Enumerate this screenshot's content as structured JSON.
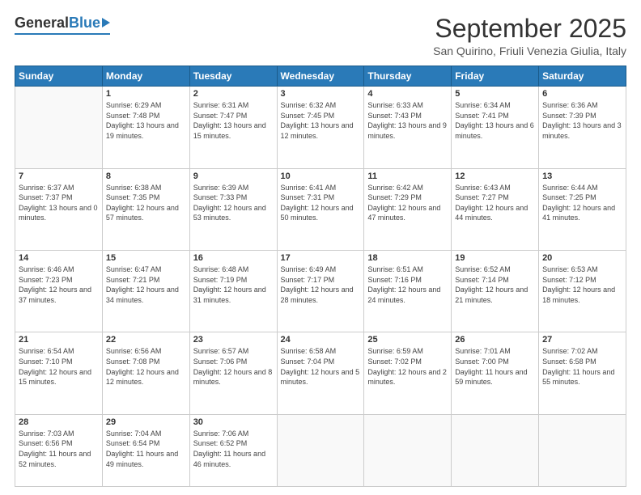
{
  "logo": {
    "general": "General",
    "blue": "Blue"
  },
  "header": {
    "month": "September 2025",
    "location": "San Quirino, Friuli Venezia Giulia, Italy"
  },
  "weekdays": [
    "Sunday",
    "Monday",
    "Tuesday",
    "Wednesday",
    "Thursday",
    "Friday",
    "Saturday"
  ],
  "weeks": [
    [
      {
        "day": "",
        "sunrise": "",
        "sunset": "",
        "daylight": ""
      },
      {
        "day": "1",
        "sunrise": "Sunrise: 6:29 AM",
        "sunset": "Sunset: 7:48 PM",
        "daylight": "Daylight: 13 hours and 19 minutes."
      },
      {
        "day": "2",
        "sunrise": "Sunrise: 6:31 AM",
        "sunset": "Sunset: 7:47 PM",
        "daylight": "Daylight: 13 hours and 15 minutes."
      },
      {
        "day": "3",
        "sunrise": "Sunrise: 6:32 AM",
        "sunset": "Sunset: 7:45 PM",
        "daylight": "Daylight: 13 hours and 12 minutes."
      },
      {
        "day": "4",
        "sunrise": "Sunrise: 6:33 AM",
        "sunset": "Sunset: 7:43 PM",
        "daylight": "Daylight: 13 hours and 9 minutes."
      },
      {
        "day": "5",
        "sunrise": "Sunrise: 6:34 AM",
        "sunset": "Sunset: 7:41 PM",
        "daylight": "Daylight: 13 hours and 6 minutes."
      },
      {
        "day": "6",
        "sunrise": "Sunrise: 6:36 AM",
        "sunset": "Sunset: 7:39 PM",
        "daylight": "Daylight: 13 hours and 3 minutes."
      }
    ],
    [
      {
        "day": "7",
        "sunrise": "Sunrise: 6:37 AM",
        "sunset": "Sunset: 7:37 PM",
        "daylight": "Daylight: 13 hours and 0 minutes."
      },
      {
        "day": "8",
        "sunrise": "Sunrise: 6:38 AM",
        "sunset": "Sunset: 7:35 PM",
        "daylight": "Daylight: 12 hours and 57 minutes."
      },
      {
        "day": "9",
        "sunrise": "Sunrise: 6:39 AM",
        "sunset": "Sunset: 7:33 PM",
        "daylight": "Daylight: 12 hours and 53 minutes."
      },
      {
        "day": "10",
        "sunrise": "Sunrise: 6:41 AM",
        "sunset": "Sunset: 7:31 PM",
        "daylight": "Daylight: 12 hours and 50 minutes."
      },
      {
        "day": "11",
        "sunrise": "Sunrise: 6:42 AM",
        "sunset": "Sunset: 7:29 PM",
        "daylight": "Daylight: 12 hours and 47 minutes."
      },
      {
        "day": "12",
        "sunrise": "Sunrise: 6:43 AM",
        "sunset": "Sunset: 7:27 PM",
        "daylight": "Daylight: 12 hours and 44 minutes."
      },
      {
        "day": "13",
        "sunrise": "Sunrise: 6:44 AM",
        "sunset": "Sunset: 7:25 PM",
        "daylight": "Daylight: 12 hours and 41 minutes."
      }
    ],
    [
      {
        "day": "14",
        "sunrise": "Sunrise: 6:46 AM",
        "sunset": "Sunset: 7:23 PM",
        "daylight": "Daylight: 12 hours and 37 minutes."
      },
      {
        "day": "15",
        "sunrise": "Sunrise: 6:47 AM",
        "sunset": "Sunset: 7:21 PM",
        "daylight": "Daylight: 12 hours and 34 minutes."
      },
      {
        "day": "16",
        "sunrise": "Sunrise: 6:48 AM",
        "sunset": "Sunset: 7:19 PM",
        "daylight": "Daylight: 12 hours and 31 minutes."
      },
      {
        "day": "17",
        "sunrise": "Sunrise: 6:49 AM",
        "sunset": "Sunset: 7:17 PM",
        "daylight": "Daylight: 12 hours and 28 minutes."
      },
      {
        "day": "18",
        "sunrise": "Sunrise: 6:51 AM",
        "sunset": "Sunset: 7:16 PM",
        "daylight": "Daylight: 12 hours and 24 minutes."
      },
      {
        "day": "19",
        "sunrise": "Sunrise: 6:52 AM",
        "sunset": "Sunset: 7:14 PM",
        "daylight": "Daylight: 12 hours and 21 minutes."
      },
      {
        "day": "20",
        "sunrise": "Sunrise: 6:53 AM",
        "sunset": "Sunset: 7:12 PM",
        "daylight": "Daylight: 12 hours and 18 minutes."
      }
    ],
    [
      {
        "day": "21",
        "sunrise": "Sunrise: 6:54 AM",
        "sunset": "Sunset: 7:10 PM",
        "daylight": "Daylight: 12 hours and 15 minutes."
      },
      {
        "day": "22",
        "sunrise": "Sunrise: 6:56 AM",
        "sunset": "Sunset: 7:08 PM",
        "daylight": "Daylight: 12 hours and 12 minutes."
      },
      {
        "day": "23",
        "sunrise": "Sunrise: 6:57 AM",
        "sunset": "Sunset: 7:06 PM",
        "daylight": "Daylight: 12 hours and 8 minutes."
      },
      {
        "day": "24",
        "sunrise": "Sunrise: 6:58 AM",
        "sunset": "Sunset: 7:04 PM",
        "daylight": "Daylight: 12 hours and 5 minutes."
      },
      {
        "day": "25",
        "sunrise": "Sunrise: 6:59 AM",
        "sunset": "Sunset: 7:02 PM",
        "daylight": "Daylight: 12 hours and 2 minutes."
      },
      {
        "day": "26",
        "sunrise": "Sunrise: 7:01 AM",
        "sunset": "Sunset: 7:00 PM",
        "daylight": "Daylight: 11 hours and 59 minutes."
      },
      {
        "day": "27",
        "sunrise": "Sunrise: 7:02 AM",
        "sunset": "Sunset: 6:58 PM",
        "daylight": "Daylight: 11 hours and 55 minutes."
      }
    ],
    [
      {
        "day": "28",
        "sunrise": "Sunrise: 7:03 AM",
        "sunset": "Sunset: 6:56 PM",
        "daylight": "Daylight: 11 hours and 52 minutes."
      },
      {
        "day": "29",
        "sunrise": "Sunrise: 7:04 AM",
        "sunset": "Sunset: 6:54 PM",
        "daylight": "Daylight: 11 hours and 49 minutes."
      },
      {
        "day": "30",
        "sunrise": "Sunrise: 7:06 AM",
        "sunset": "Sunset: 6:52 PM",
        "daylight": "Daylight: 11 hours and 46 minutes."
      },
      {
        "day": "",
        "sunrise": "",
        "sunset": "",
        "daylight": ""
      },
      {
        "day": "",
        "sunrise": "",
        "sunset": "",
        "daylight": ""
      },
      {
        "day": "",
        "sunrise": "",
        "sunset": "",
        "daylight": ""
      },
      {
        "day": "",
        "sunrise": "",
        "sunset": "",
        "daylight": ""
      }
    ]
  ]
}
